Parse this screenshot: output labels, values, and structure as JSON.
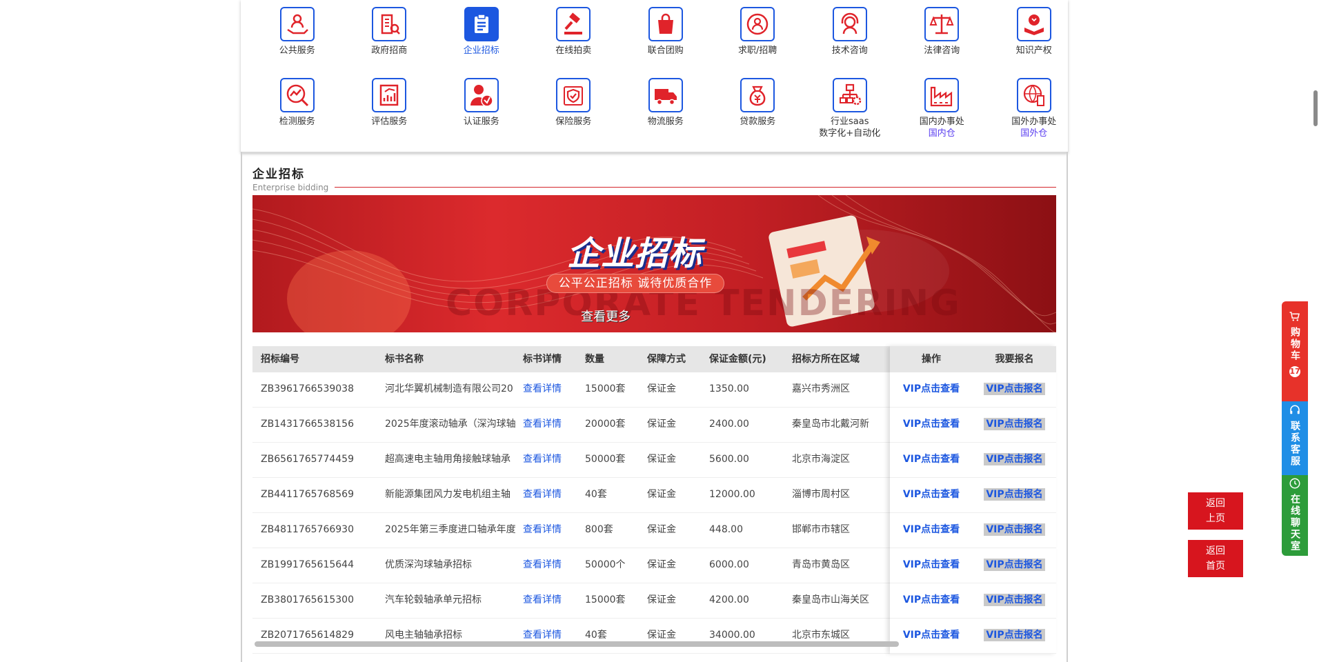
{
  "categories": [
    {
      "label": "公共服务",
      "icon": "hand-user-icon"
    },
    {
      "label": "政府招商",
      "icon": "building-search-icon"
    },
    {
      "label": "企业招标",
      "icon": "clipboard-icon",
      "active": true
    },
    {
      "label": "在线拍卖",
      "icon": "gavel-icon"
    },
    {
      "label": "联合团购",
      "icon": "shopping-bag-icon"
    },
    {
      "label": "求职/招聘",
      "icon": "job-user-icon"
    },
    {
      "label": "技术咨询",
      "icon": "headset-icon"
    },
    {
      "label": "法律咨询",
      "icon": "scales-icon"
    },
    {
      "label": "知识产权",
      "icon": "bulb-book-icon"
    },
    {
      "label": "检测服务",
      "icon": "chart-magnifier-icon"
    },
    {
      "label": "评估服务",
      "icon": "report-chart-icon"
    },
    {
      "label": "认证服务",
      "icon": "user-verified-icon"
    },
    {
      "label": "保险服务",
      "icon": "shield-check-icon"
    },
    {
      "label": "物流服务",
      "icon": "truck-icon"
    },
    {
      "label": "贷款服务",
      "icon": "money-bag-icon"
    },
    {
      "label": "行业saas",
      "sub2": "数字化+自动化",
      "icon": "network-gear-icon"
    },
    {
      "label": "国内办事处",
      "sub": "国内仓",
      "icon": "factory-icon"
    },
    {
      "label": "国外办事处",
      "sub": "国外仓",
      "icon": "globe-building-icon"
    }
  ],
  "section": {
    "title": "企业招标",
    "subtitle": "Enterprise bidding"
  },
  "banner": {
    "title": "企业招标",
    "slogan": "公平公正招标  诚待优质合作",
    "bg_text": "CORPORATE TENDERING",
    "more": "查看更多"
  },
  "table": {
    "headers": [
      "招标编号",
      "标书名称",
      "标书详情",
      "数量",
      "保障方式",
      "保证金额(元)",
      "招标方所在区域"
    ],
    "fixed_headers": [
      "操作",
      "我要报名"
    ],
    "detail_label": "查看详情",
    "action_label": "VIP点击查看",
    "signup_label": "VIP点击报名",
    "rows": [
      [
        "ZB3961766539038",
        "河北华翼机械制造有限公司20",
        "查看详情",
        "15000套",
        "保证金",
        "1350.00",
        "嘉兴市秀洲区"
      ],
      [
        "ZB1431766538156",
        "2025年度滚动轴承（深沟球轴",
        "查看详情",
        "20000套",
        "保证金",
        "2400.00",
        "秦皇岛市北戴河新"
      ],
      [
        "ZB6561765774459",
        "超高速电主轴用角接触球轴承",
        "查看详情",
        "50000套",
        "保证金",
        "5600.00",
        "北京市海淀区"
      ],
      [
        "ZB4411765768569",
        "新能源集团风力发电机组主轴",
        "查看详情",
        "40套",
        "保证金",
        "12000.00",
        "淄博市周村区"
      ],
      [
        "ZB4811765766930",
        "2025年第三季度进口轴承年度",
        "查看详情",
        "800套",
        "保证金",
        "448.00",
        "邯郸市市辖区"
      ],
      [
        "ZB1991765615644",
        "优质深沟球轴承招标",
        "查看详情",
        "50000个",
        "保证金",
        "6000.00",
        "青岛市黄岛区"
      ],
      [
        "ZB3801765615300",
        "汽车轮毂轴承单元招标",
        "查看详情",
        "15000套",
        "保证金",
        "4200.00",
        "秦皇岛市山海关区"
      ],
      [
        "ZB2071765614829",
        "风电主轴轴承招标",
        "查看详情",
        "40套",
        "保证金",
        "34000.00",
        "北京市东城区"
      ]
    ]
  },
  "sidebar": {
    "cart": "购物车",
    "cart_count": "17",
    "service": "联系客服",
    "chat": "在线聊天室",
    "back_line1": "返回",
    "back_line2": "上页",
    "home_line1": "返回",
    "home_line2": "首页"
  },
  "colors": {
    "accent": "#1c57e0",
    "brand_red": "#d7151e",
    "cart": "#e7322a",
    "service": "#1f8ee6",
    "chat": "#2d9c3a"
  }
}
